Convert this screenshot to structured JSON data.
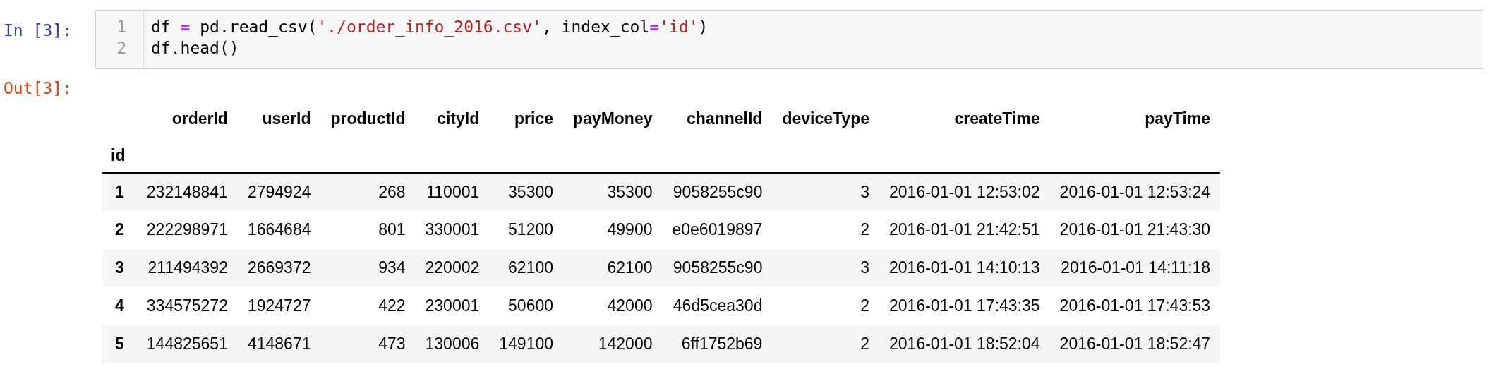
{
  "input_prompt": "In [3]:",
  "code": {
    "lines": [
      {
        "number": "1",
        "tokens": [
          {
            "kind": "plain",
            "text": "df "
          },
          {
            "kind": "operator",
            "text": "="
          },
          {
            "kind": "plain",
            "text": " pd.read_csv("
          },
          {
            "kind": "string",
            "text": "'./order_info_2016.csv'"
          },
          {
            "kind": "plain",
            "text": ", index_col"
          },
          {
            "kind": "operator",
            "text": "="
          },
          {
            "kind": "string",
            "text": "'id'"
          },
          {
            "kind": "plain",
            "text": ")"
          }
        ]
      },
      {
        "number": "2",
        "tokens": [
          {
            "kind": "plain",
            "text": "df.head()"
          }
        ]
      }
    ]
  },
  "output_prompt": "Out[3]:",
  "table": {
    "columns": [
      "orderId",
      "userId",
      "productId",
      "cityId",
      "price",
      "payMoney",
      "channelId",
      "deviceType",
      "createTime",
      "payTime"
    ],
    "index_name": "id",
    "rows": [
      {
        "index": "1",
        "cells": [
          "232148841",
          "2794924",
          "268",
          "110001",
          "35300",
          "35300",
          "9058255c90",
          "3",
          "2016-01-01 12:53:02",
          "2016-01-01 12:53:24"
        ]
      },
      {
        "index": "2",
        "cells": [
          "222298971",
          "1664684",
          "801",
          "330001",
          "51200",
          "49900",
          "e0e6019897",
          "2",
          "2016-01-01 21:42:51",
          "2016-01-01 21:43:30"
        ]
      },
      {
        "index": "3",
        "cells": [
          "211494392",
          "2669372",
          "934",
          "220002",
          "62100",
          "62100",
          "9058255c90",
          "3",
          "2016-01-01 14:10:13",
          "2016-01-01 14:11:18"
        ]
      },
      {
        "index": "4",
        "cells": [
          "334575272",
          "1924727",
          "422",
          "230001",
          "50600",
          "42000",
          "46d5cea30d",
          "2",
          "2016-01-01 17:43:35",
          "2016-01-01 17:43:53"
        ]
      },
      {
        "index": "5",
        "cells": [
          "144825651",
          "4148671",
          "473",
          "130006",
          "149100",
          "142000",
          "6ff1752b69",
          "2",
          "2016-01-01 18:52:04",
          "2016-01-01 18:52:47"
        ]
      }
    ]
  }
}
